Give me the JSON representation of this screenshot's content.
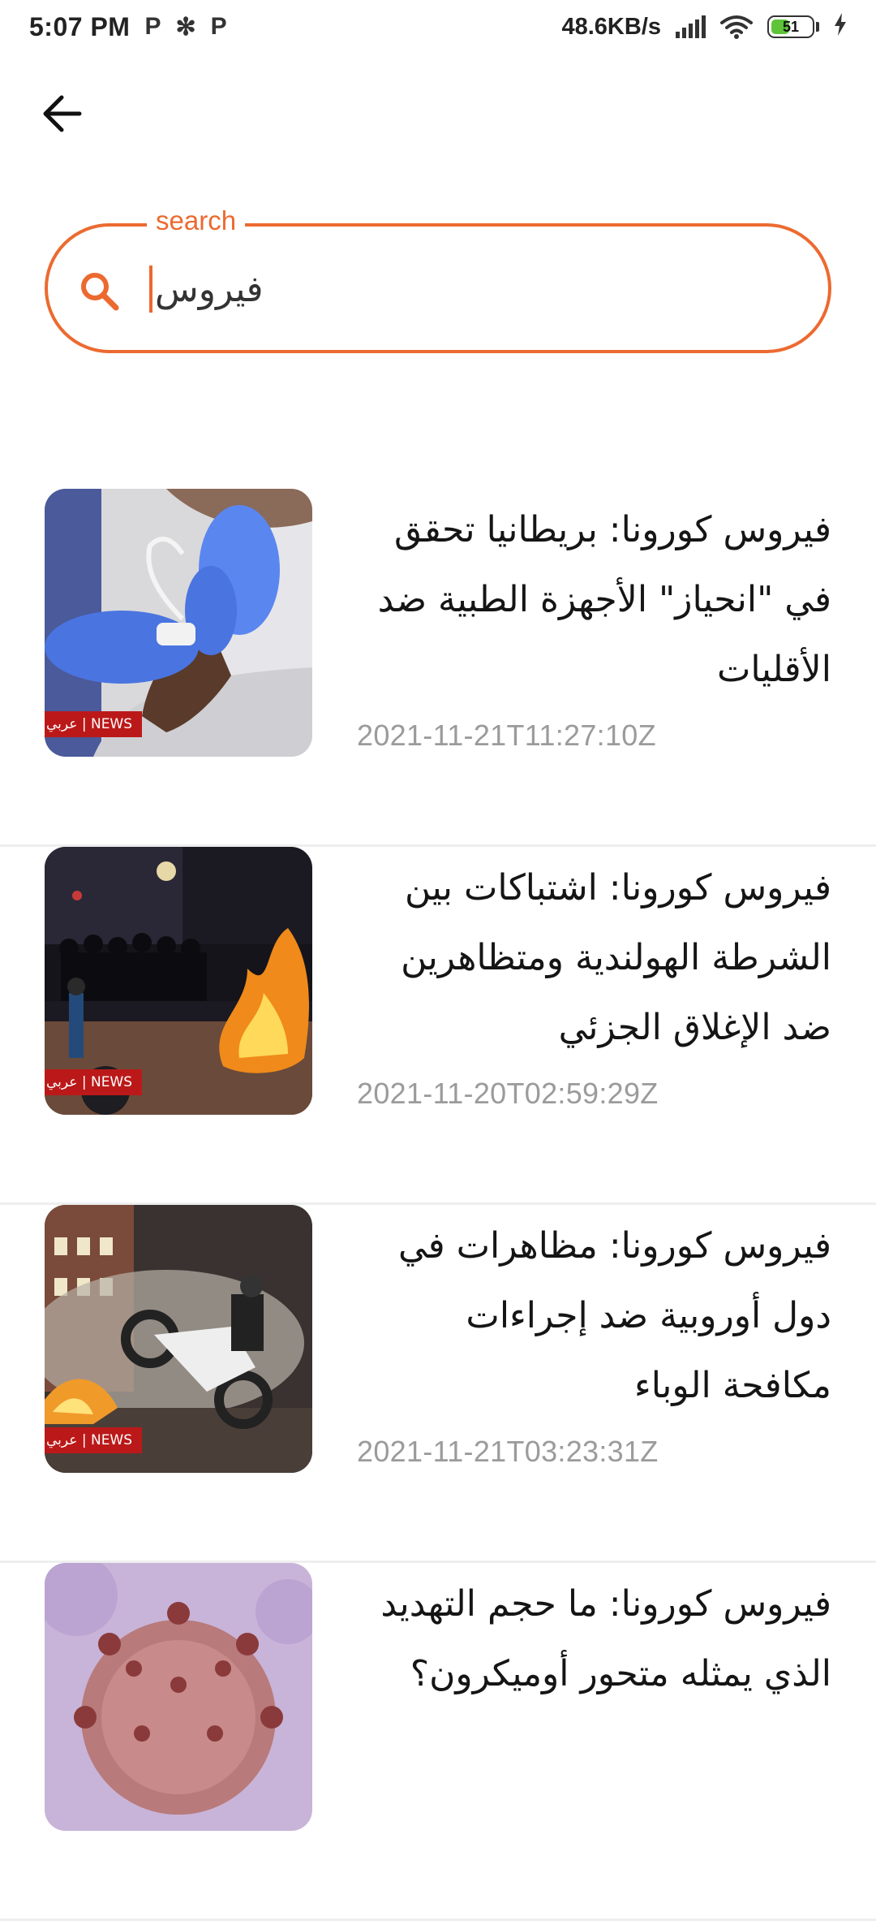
{
  "status_bar": {
    "time": "5:07 PM",
    "notification_icons": [
      "P",
      "✻",
      "P"
    ],
    "net_speed": "48.6KB/s",
    "battery_level": "51",
    "battery_fraction": 0.51
  },
  "header": {
    "back_icon": "arrow-left-icon"
  },
  "search": {
    "label": "search",
    "value": "فيروس",
    "accent_color": "#ec6a30"
  },
  "articles": [
    {
      "title": "فيروس كورونا: بريطانيا تحقق في \"انحياز\" الأجهزة الطبية ضد الأقليات",
      "date": "2021-11-21T11:27:10Z",
      "badge": "عربي | NEWS"
    },
    {
      "title": "فيروس كورونا: اشتباكات بين الشرطة الهولندية ومتظاهرين ضد الإغلاق الجزئي",
      "date": "2021-11-20T02:59:29Z",
      "badge": "عربي | NEWS"
    },
    {
      "title": "فيروس كورونا: مظاهرات في دول أوروبية ضد إجراءات مكافحة الوباء",
      "date": "2021-11-21T03:23:31Z",
      "badge": "عربي | NEWS"
    },
    {
      "title": "فيروس كورونا: ما حجم التهديد الذي يمثله متحور أوميكرون؟",
      "date": "",
      "badge": ""
    }
  ]
}
